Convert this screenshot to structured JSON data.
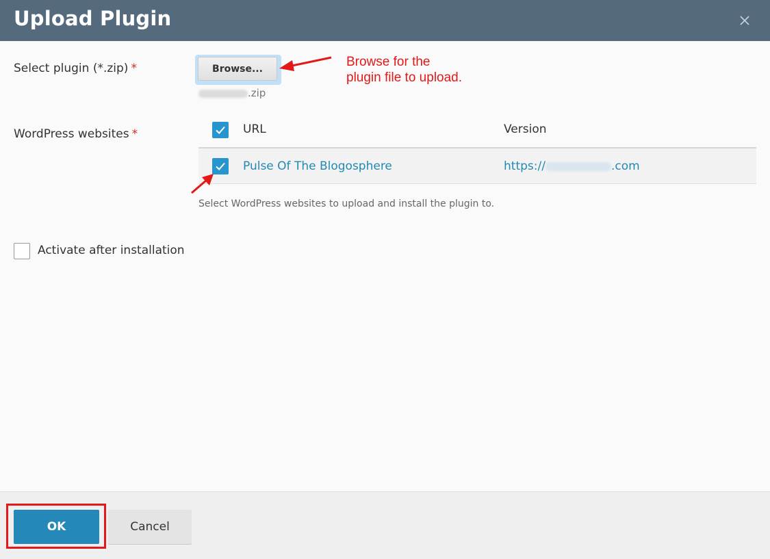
{
  "dialog": {
    "title": "Upload Plugin",
    "close_icon": "close-icon"
  },
  "plugin_select": {
    "label": "Select plugin (*.zip)",
    "required_mark": "*",
    "browse_label": "Browse...",
    "file_suffix": ".zip"
  },
  "annotation": {
    "line1": "Browse for the",
    "line2": "plugin file to upload."
  },
  "websites": {
    "label": "WordPress websites",
    "required_mark": "*",
    "columns": {
      "url": "URL",
      "version": "Version"
    },
    "header_checked": true,
    "rows": [
      {
        "checked": true,
        "name": "Pulse Of The Blogosphere",
        "url_prefix": "https://",
        "url_suffix": ".com"
      }
    ],
    "hint": "Select WordPress websites to upload and install the plugin to."
  },
  "activate": {
    "label": "Activate after installation",
    "checked": false
  },
  "footer": {
    "ok_label": "OK",
    "cancel_label": "Cancel"
  },
  "colors": {
    "header": "#566a7e",
    "accent": "#2489b9",
    "annotation": "#e31818",
    "link": "#2289b4"
  }
}
